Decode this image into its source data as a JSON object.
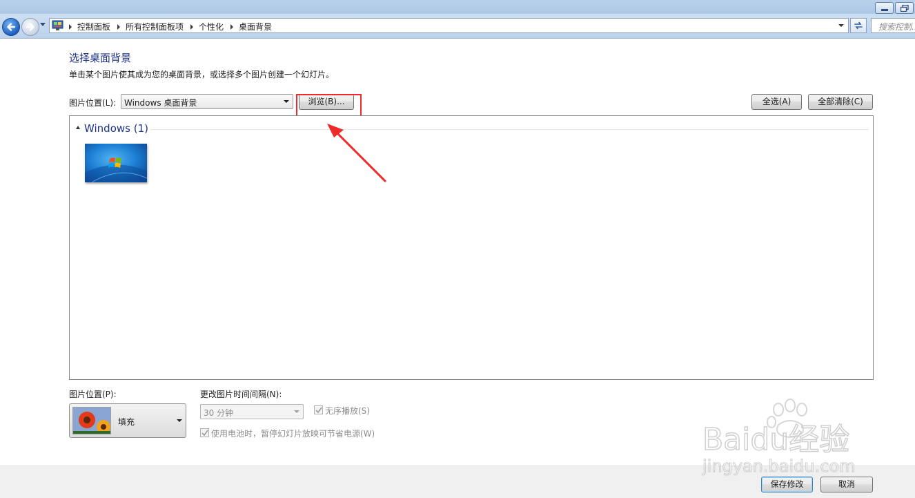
{
  "address_bar": {
    "crumbs": [
      "控制面板",
      "所有控制面板项",
      "个性化",
      "桌面背景"
    ],
    "search_placeholder": "搜索控制..."
  },
  "page": {
    "title": "选择桌面背景",
    "description": "单击某个图片使其成为您的桌面背景，或选择多个图片创建一个幻灯片。"
  },
  "picture_location": {
    "label": "图片位置(L):",
    "value": "Windows 桌面背景",
    "browse_label": "浏览(B)...",
    "select_all_label": "全选(A)",
    "clear_all_label": "全部清除(C)"
  },
  "gallery": {
    "group_title": "Windows (1)",
    "thumbnails": [
      {
        "name": "Windows 7 default wallpaper",
        "selected": false
      }
    ]
  },
  "position": {
    "label": "图片位置(P):",
    "value": "填充"
  },
  "interval": {
    "label": "更改图片时间间隔(N):",
    "value": "30 分钟"
  },
  "shuffle": {
    "label": "无序播放(S)",
    "checked": true,
    "enabled": false
  },
  "battery": {
    "label": "使用电池时，暂停幻灯片放映可节省电源(W)",
    "checked": true,
    "enabled": false
  },
  "footer": {
    "save_label": "保存修改",
    "cancel_label": "取消"
  },
  "watermark": {
    "brand": "Baidu经验",
    "url": "jingyan.baidu.com"
  },
  "colors": {
    "title_blue": "#1e3287",
    "annotation_red": "#ee2a2a"
  }
}
